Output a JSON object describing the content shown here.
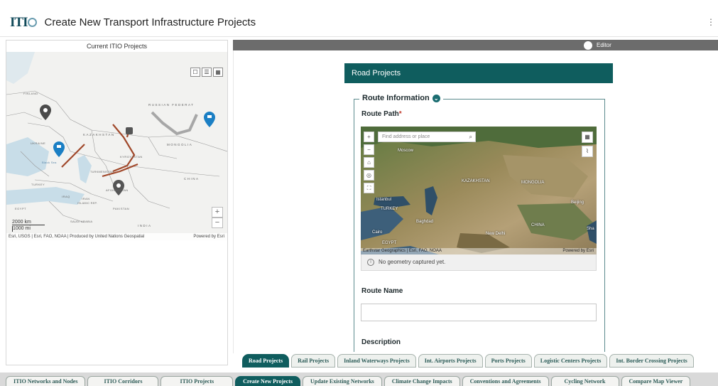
{
  "header": {
    "logo": "ITIO",
    "title": "Create New Transport Infrastructure Projects",
    "more_icon": "more-icon"
  },
  "left": {
    "title": "Current ITIO Projects",
    "map_labels": [
      "RUSSIAN FEDERAT",
      "FINLAND",
      "UKRAINE",
      "KAZAKHSTAN",
      "MONGOLIA",
      "KYRGYZSTAN",
      "CHINA",
      "TURKEY",
      "IRAQ",
      "IRAN",
      "PAKISTAN",
      "INDIA",
      "AFGHANISTAN",
      "SAUDI ARABIA",
      "EGYPT",
      "Black Sea",
      "ISLAMIC REP.",
      "TURKMENISTAN"
    ],
    "scale_km": "2000 km",
    "scale_mi": "1000 mi",
    "attribution": "Esri, USGS | Esri, FAO, NOAA | Produced by United Nations Geospatial",
    "powered": "Powered by Esri",
    "zoom_in": "+",
    "zoom_out": "−"
  },
  "editor": {
    "label": "Editor"
  },
  "form": {
    "header": "Road Projects",
    "section": "Route Information",
    "route_path_label": "Route Path",
    "required_mark": "*",
    "search_placeholder": "Find address or place",
    "map_labels": [
      "Moscow",
      "KAZAKHSTAN",
      "MONGOLIA",
      "Istanbul",
      "TURKEY",
      "Beijing",
      "CHINA",
      "Baghdad",
      "New Delhi",
      "Cairo",
      "EGYPT",
      "Sha"
    ],
    "sat_attribution": "Earthstar Geographics | Esri, FAO, NOAA",
    "sat_powered": "Powered by Esri",
    "no_geometry": "No geometry captured yet.",
    "route_name_label": "Route Name",
    "route_name_value": "",
    "description_label": "Description"
  },
  "subtabs": [
    {
      "label": "Road Projects",
      "active": true
    },
    {
      "label": "Rail Projects",
      "active": false
    },
    {
      "label": "Inland Waterways Projects",
      "active": false
    },
    {
      "label": "Int. Airports Projects",
      "active": false
    },
    {
      "label": "Ports Projects",
      "active": false
    },
    {
      "label": "Logistic Centers Projects",
      "active": false
    },
    {
      "label": "Int. Border Crossing Projects",
      "active": false
    }
  ],
  "bottom_tabs": [
    {
      "label": "ITIO Networks and Nodes",
      "active": false
    },
    {
      "label": "ITIO Corridors",
      "active": false
    },
    {
      "label": "ITIO Projects",
      "active": false
    },
    {
      "label": "Create New Projects",
      "active": true
    },
    {
      "label": "Update Existing Networks",
      "active": false
    },
    {
      "label": "Climate Change Impacts",
      "active": false
    },
    {
      "label": "Conventions and Agreements",
      "active": false
    },
    {
      "label": "Cycling Network",
      "active": false
    },
    {
      "label": "Compare Map Viewer",
      "active": false
    }
  ],
  "colors": {
    "primary": "#0f5d5e",
    "route_line": "#a0482a",
    "marker_blue": "#1b7fc4",
    "marker_dark": "#4a4a4a"
  }
}
